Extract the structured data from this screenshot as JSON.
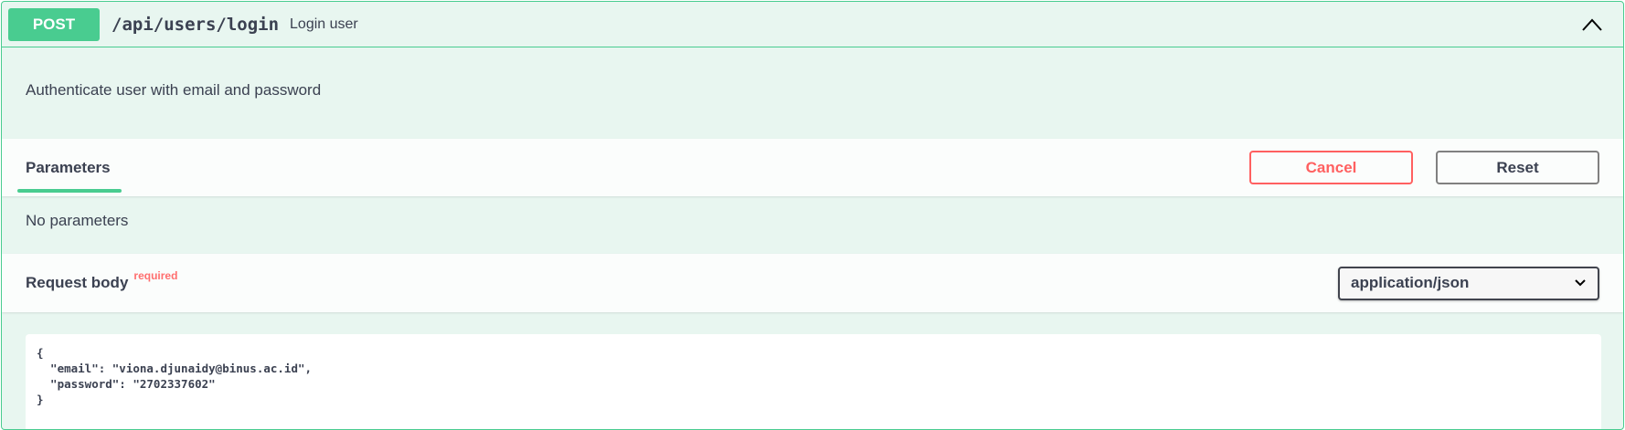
{
  "operation": {
    "method": "POST",
    "path": "/api/users/login",
    "summary": "Login user",
    "description": "Authenticate user with email and password"
  },
  "parameters": {
    "tab_label": "Parameters",
    "cancel_label": "Cancel",
    "reset_label": "Reset",
    "empty_text": "No parameters"
  },
  "request_body": {
    "title": "Request body",
    "required_label": "required",
    "content_type": "application/json",
    "example": "{\n  \"email\": \"viona.djunaidy@binus.ac.id\",\n  \"password\": \"2702337602\"\n}"
  },
  "icons": {
    "collapse": "chevron-up-icon",
    "select_caret": "chevron-down-icon"
  },
  "colors": {
    "post_green": "#49cc90",
    "block_bg": "#e8f6f0",
    "cancel_red": "#ff6060",
    "text": "#3b4151"
  }
}
